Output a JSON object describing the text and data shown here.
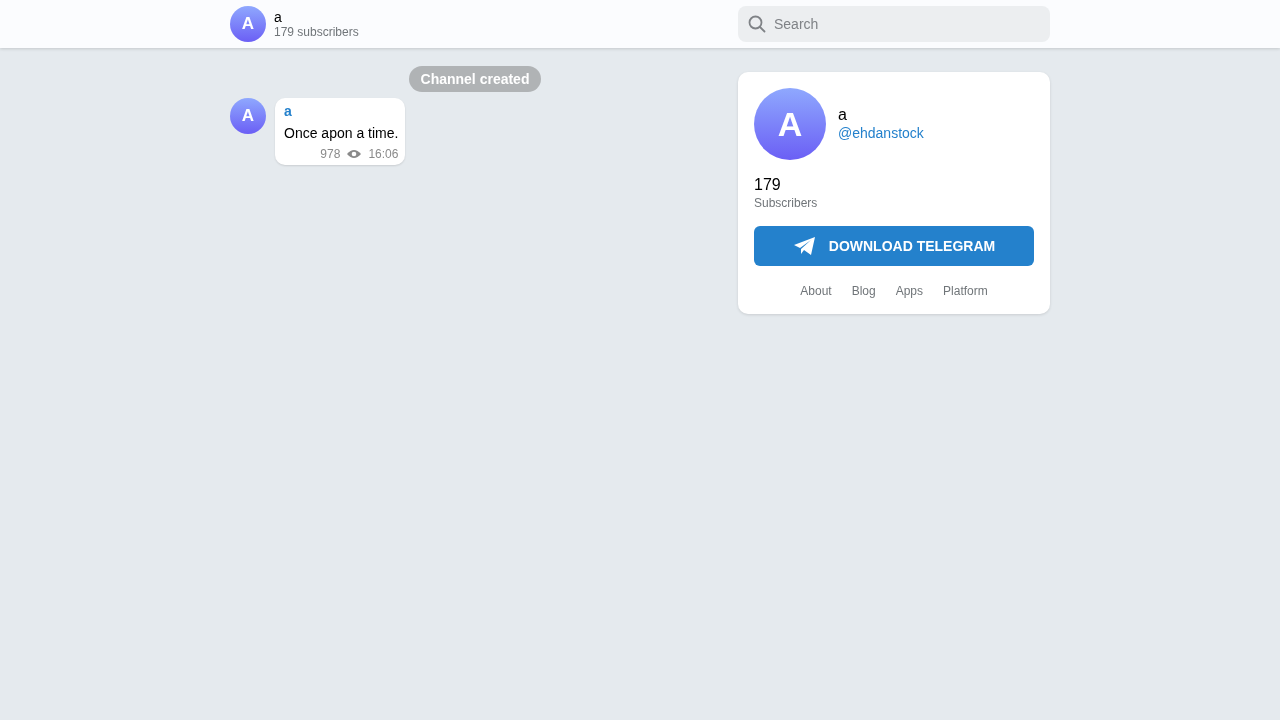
{
  "header": {
    "avatar_letter": "A",
    "title": "a",
    "subtitle": "179 subscribers"
  },
  "search": {
    "placeholder": "Search"
  },
  "service_message": "Channel created",
  "messages": [
    {
      "avatar_letter": "A",
      "author": "a",
      "text": "Once apon a time.",
      "views": "978",
      "time": "16:06"
    }
  ],
  "card": {
    "avatar_letter": "A",
    "name": "a",
    "username": "@ehdanstock",
    "count": "179",
    "count_label": "Subscribers",
    "button": "DOWNLOAD TELEGRAM",
    "links": [
      "About",
      "Blog",
      "Apps",
      "Platform"
    ]
  }
}
